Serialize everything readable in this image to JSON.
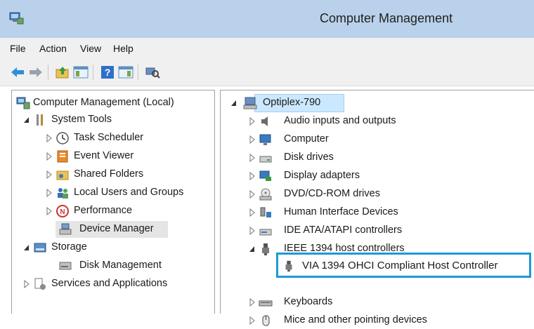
{
  "window": {
    "title": "Computer Management"
  },
  "menu": [
    "File",
    "Action",
    "View",
    "Help"
  ],
  "toolbar": {
    "buttons": [
      "back-icon",
      "forward-icon",
      "up-folder-icon",
      "show-hide-console-tree-icon",
      "help-icon",
      "show-hide-action-pane-icon",
      "scan-hardware-icon"
    ]
  },
  "left_tree": [
    {
      "label": "Computer Management (Local)",
      "icon": "computer-management-icon",
      "expander": "none"
    },
    {
      "label": "System Tools",
      "icon": "tools-icon",
      "expander": "expanded"
    },
    {
      "label": "Task Scheduler",
      "icon": "clock-icon",
      "expander": "collapsed"
    },
    {
      "label": "Event Viewer",
      "icon": "event-viewer-icon",
      "expander": "collapsed"
    },
    {
      "label": "Shared Folders",
      "icon": "shared-folder-icon",
      "expander": "collapsed"
    },
    {
      "label": "Local Users and Groups",
      "icon": "users-icon",
      "expander": "collapsed"
    },
    {
      "label": "Performance",
      "icon": "performance-icon",
      "expander": "collapsed"
    },
    {
      "label": "Device Manager",
      "icon": "device-manager-icon",
      "expander": "none",
      "selected": true
    },
    {
      "label": "Storage",
      "icon": "storage-icon",
      "expander": "expanded"
    },
    {
      "label": "Disk Management",
      "icon": "disk-management-icon",
      "expander": "none"
    },
    {
      "label": "Services and Applications",
      "icon": "services-icon",
      "expander": "collapsed"
    }
  ],
  "right_tree": {
    "root": {
      "label": "Optiplex-790",
      "icon": "computer-icon"
    },
    "items": [
      {
        "label": "Audio inputs and outputs",
        "icon": "speaker-icon",
        "expander": "collapsed"
      },
      {
        "label": "Computer",
        "icon": "monitor-icon",
        "expander": "collapsed"
      },
      {
        "label": "Disk drives",
        "icon": "disk-drive-icon",
        "expander": "collapsed"
      },
      {
        "label": "Display adapters",
        "icon": "display-adapter-icon",
        "expander": "collapsed"
      },
      {
        "label": "DVD/CD-ROM drives",
        "icon": "dvd-icon",
        "expander": "collapsed"
      },
      {
        "label": "Human Interface Devices",
        "icon": "hid-icon",
        "expander": "collapsed"
      },
      {
        "label": "IDE ATA/ATAPI controllers",
        "icon": "ide-controller-icon",
        "expander": "collapsed"
      },
      {
        "label": "IEEE 1394 host controllers",
        "icon": "firewire-icon",
        "expander": "expanded"
      },
      {
        "label": "VIA 1394 OHCI Compliant Host Controller",
        "icon": "firewire-device-icon",
        "expander": "none",
        "highlighted": true
      },
      {
        "label": "Keyboards",
        "icon": "keyboard-icon",
        "expander": "collapsed"
      },
      {
        "label": "Mice and other pointing devices",
        "icon": "mouse-icon",
        "expander": "collapsed"
      }
    ]
  },
  "colors": {
    "titlebar": "#b9d1ea",
    "highlight_border": "#1c9ad6",
    "selection": "#cce8ff"
  }
}
